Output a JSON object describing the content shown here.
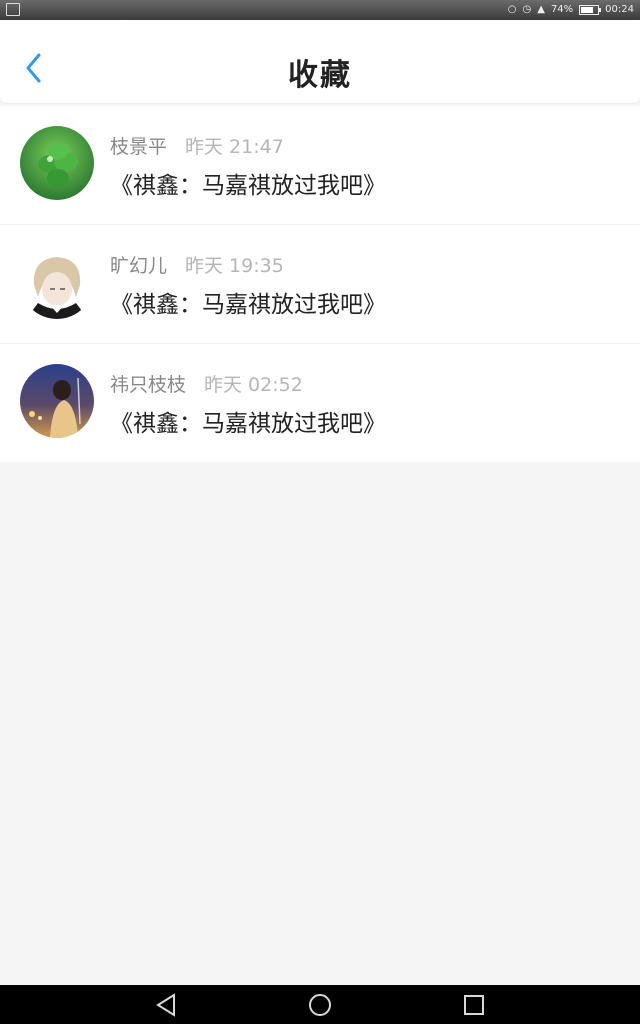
{
  "status": {
    "battery_pct": "74%",
    "battery_level": 0.74,
    "time": "00:24"
  },
  "header": {
    "title": "收藏"
  },
  "favorites": [
    {
      "user": "枝景平",
      "time": "昨天 21:47",
      "title": "《祺鑫：马嘉祺放过我吧》",
      "avatar": "clover-avatar"
    },
    {
      "user": "旷幻儿",
      "time": "昨天 19:35",
      "title": "《祺鑫：马嘉祺放过我吧》",
      "avatar": "anime-avatar"
    },
    {
      "user": "祎只枝枝",
      "time": "昨天 02:52",
      "title": "《祺鑫：马嘉祺放过我吧》",
      "avatar": "photo-avatar"
    }
  ],
  "colors": {
    "accent": "#2f9bee",
    "background": "#f5f5f5"
  }
}
